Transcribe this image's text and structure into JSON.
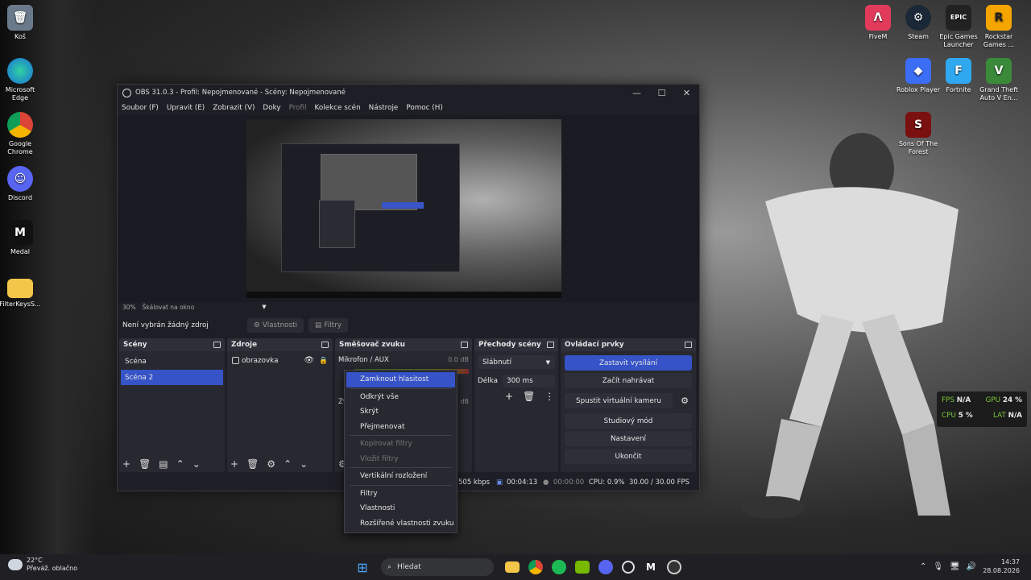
{
  "desktop": {
    "left_icons": [
      {
        "label": "Koš",
        "icon": "recycle-bin-icon"
      },
      {
        "label": "Microsoft Edge",
        "icon": "edge-icon"
      },
      {
        "label": "Google Chrome",
        "icon": "chrome-icon"
      },
      {
        "label": "Discord",
        "icon": "discord-icon"
      },
      {
        "label": "Medal",
        "icon": "medal-icon"
      },
      {
        "label": "FilterKeysS...",
        "icon": "folder-icon"
      }
    ],
    "right_icons": [
      {
        "label": "FiveM",
        "icon": "fivem-icon"
      },
      {
        "label": "Steam",
        "icon": "steam-icon"
      },
      {
        "label": "Epic Games Launcher",
        "icon": "epic-games-icon"
      },
      {
        "label": "Rockstar Games ...",
        "icon": "rockstar-icon"
      },
      {
        "label": "Roblox Player",
        "icon": "roblox-icon"
      },
      {
        "label": "Fortnite",
        "icon": "fortnite-icon"
      },
      {
        "label": "Grand Theft Auto V En...",
        "icon": "gta-icon"
      },
      {
        "label": "Sons Of The Forest",
        "icon": "sons-forest-icon"
      }
    ]
  },
  "window": {
    "title": "OBS 31.0.3 - Profil: Nepojmenované - Scény: Nepojmenované",
    "controls": {
      "minimize": "—",
      "maximize": "☐",
      "close": "✕"
    }
  },
  "menubar": [
    "Soubor (F)",
    "Upravit (E)",
    "Zobrazit (V)",
    "Doky",
    "Profil",
    "Kolekce scén",
    "Nástroje",
    "Pomoc (H)"
  ],
  "preview": {
    "zoom": "30%",
    "scale_mode": "Škálovat na okno"
  },
  "source_toolbar": {
    "no_source": "Není vybrán žádný zdroj",
    "properties": "Vlastnosti",
    "filters": "Filtry"
  },
  "scenes": {
    "title": "Scény",
    "items": [
      "Scéna",
      "Scéna 2"
    ],
    "selected": "Scéna 2"
  },
  "sources": {
    "title": "Zdroje",
    "items": [
      "obrazovka"
    ]
  },
  "mixer": {
    "title": "Směšovač zvuku",
    "channels": [
      {
        "name": "Mikrofon / AUX",
        "db": "0.0 dB"
      },
      {
        "name": "Zv",
        "db": "dB"
      }
    ]
  },
  "transitions": {
    "title": "Přechody scény",
    "selected": "Slábnutí",
    "duration_label": "Délka",
    "duration_value": "300 ms"
  },
  "controls": {
    "title": "Ovládací prvky",
    "buttons": [
      "Zastavit vysílání",
      "Začít nahrávat",
      "Spustit virtuální kameru",
      "Studiový mód",
      "Nastavení",
      "Ukončit"
    ]
  },
  "status_bar": {
    "bitrate": "505 kbps",
    "stream_time": "00:04:13",
    "rec_time": "00:00:00",
    "cpu": "CPU: 0.9%",
    "fps": "30.00 / 30.00 FPS"
  },
  "context_menu": {
    "items": [
      {
        "label": "Zamknout hlasitost",
        "state": "highlighted"
      },
      {
        "label": "Odkrýt vše",
        "state": "normal"
      },
      {
        "label": "Skrýt",
        "state": "normal"
      },
      {
        "label": "Přejmenovat",
        "state": "normal"
      },
      {
        "label": "Kopírovat filtry",
        "state": "disabled"
      },
      {
        "label": "Vložit filtry",
        "state": "disabled"
      },
      {
        "label": "Vertikální rozložení",
        "state": "normal"
      },
      {
        "label": "Filtry",
        "state": "normal"
      },
      {
        "label": "Vlastnosti",
        "state": "normal"
      },
      {
        "label": "Rozšířené vlastnosti zvuku",
        "state": "normal"
      }
    ]
  },
  "overlay": {
    "fps_label": "FPS",
    "fps_value": "N/A",
    "gpu_label": "GPU",
    "gpu_value": "24 %",
    "cpu_label": "CPU",
    "cpu_value": "5 %",
    "lat_label": "LAT",
    "lat_value": "N/A"
  },
  "taskbar": {
    "weather_temp": "22°C",
    "weather_desc": "Převáž. oblačno",
    "search_placeholder": "Hledat",
    "time": "14:37",
    "date": "28.08.2026"
  },
  "colors": {
    "accent": "#3653c7",
    "window_bg": "#1e1f26",
    "dock_bg": "#272830",
    "overlay_green": "#7dc83a"
  }
}
